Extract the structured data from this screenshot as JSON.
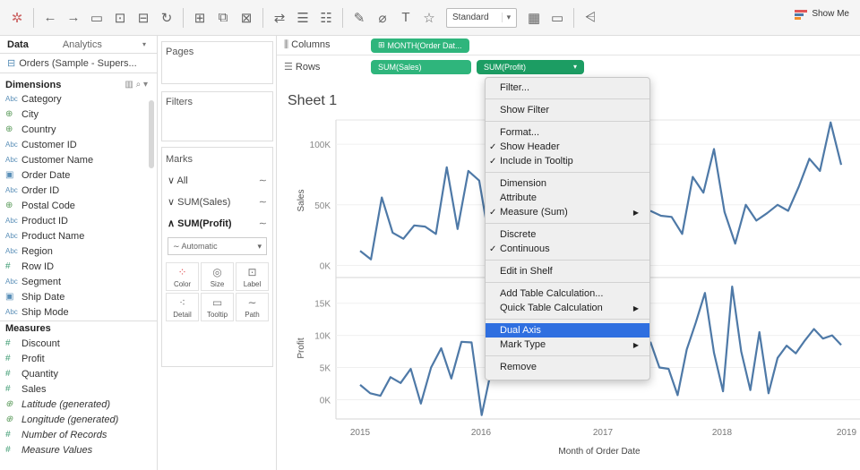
{
  "toolbar": {
    "standard_label": "Standard",
    "show_me": "Show Me"
  },
  "data_pane": {
    "tabs": [
      "Data",
      "Analytics"
    ],
    "data_source": "Orders (Sample - Supers...",
    "dimensions_label": "Dimensions",
    "dimensions": [
      {
        "name": "Category",
        "type": "Abc"
      },
      {
        "name": "City",
        "type": "globe"
      },
      {
        "name": "Country",
        "type": "globe"
      },
      {
        "name": "Customer ID",
        "type": "Abc"
      },
      {
        "name": "Customer Name",
        "type": "Abc"
      },
      {
        "name": "Order Date",
        "type": "cal"
      },
      {
        "name": "Order ID",
        "type": "Abc"
      },
      {
        "name": "Postal Code",
        "type": "globe"
      },
      {
        "name": "Product ID",
        "type": "Abc"
      },
      {
        "name": "Product Name",
        "type": "Abc"
      },
      {
        "name": "Region",
        "type": "Abc"
      },
      {
        "name": "Row ID",
        "type": "num"
      },
      {
        "name": "Segment",
        "type": "Abc"
      },
      {
        "name": "Ship Date",
        "type": "cal"
      },
      {
        "name": "Ship Mode",
        "type": "Abc"
      }
    ],
    "measures_label": "Measures",
    "measures": [
      {
        "name": "Discount",
        "type": "num",
        "italic": false
      },
      {
        "name": "Profit",
        "type": "num",
        "italic": false
      },
      {
        "name": "Quantity",
        "type": "num",
        "italic": false
      },
      {
        "name": "Sales",
        "type": "num",
        "italic": false
      },
      {
        "name": "Latitude (generated)",
        "type": "globe",
        "italic": true
      },
      {
        "name": "Longitude (generated)",
        "type": "globe",
        "italic": true
      },
      {
        "name": "Number of Records",
        "type": "num",
        "italic": true
      },
      {
        "name": "Measure Values",
        "type": "num",
        "italic": true
      }
    ]
  },
  "shelves": {
    "pages_label": "Pages",
    "filters_label": "Filters",
    "marks_label": "Marks",
    "marks_rows": [
      "All",
      "SUM(Sales)",
      "SUM(Profit)"
    ],
    "mark_type": "Automatic",
    "mark_buttons": [
      "Color",
      "Size",
      "Label",
      "Detail",
      "Tooltip",
      "Path"
    ],
    "columns_label": "Columns",
    "rows_label": "Rows",
    "columns_pill": "MONTH(Order Dat...",
    "rows_pills": [
      "SUM(Sales)",
      "SUM(Profit)"
    ]
  },
  "view": {
    "sheet_title": "Sheet 1",
    "x_axis_title": "Month of Order Date",
    "x_ticks": [
      "2015",
      "2016",
      "2017",
      "2018",
      "2019"
    ],
    "sales_axis_title": "Sales",
    "sales_ticks": [
      "100K",
      "50K",
      "0K"
    ],
    "profit_axis_title": "Profit",
    "profit_ticks": [
      "15K",
      "10K",
      "5K",
      "0K"
    ]
  },
  "context_menu": {
    "items": [
      {
        "label": "Filter...",
        "check": false,
        "arrow": false
      },
      "sep",
      {
        "label": "Show Filter",
        "check": false,
        "arrow": false
      },
      "sep",
      {
        "label": "Format...",
        "check": false,
        "arrow": false
      },
      {
        "label": "Show Header",
        "check": true,
        "arrow": false
      },
      {
        "label": "Include in Tooltip",
        "check": true,
        "arrow": false
      },
      "sep",
      {
        "label": "Dimension",
        "check": false,
        "arrow": false
      },
      {
        "label": "Attribute",
        "check": false,
        "arrow": false
      },
      {
        "label": "Measure (Sum)",
        "check": true,
        "arrow": true
      },
      "sep",
      {
        "label": "Discrete",
        "check": false,
        "arrow": false
      },
      {
        "label": "Continuous",
        "check": true,
        "arrow": false
      },
      "sep",
      {
        "label": "Edit in Shelf",
        "check": false,
        "arrow": false
      },
      "sep",
      {
        "label": "Add Table Calculation...",
        "check": false,
        "arrow": false
      },
      {
        "label": "Quick Table Calculation",
        "check": false,
        "arrow": true
      },
      "sep",
      {
        "label": "Dual Axis",
        "check": false,
        "arrow": false,
        "highlight": true
      },
      {
        "label": "Mark Type",
        "check": false,
        "arrow": true
      },
      "sep",
      {
        "label": "Remove",
        "check": false,
        "arrow": false
      }
    ]
  },
  "colors": {
    "pill_green": "#2fb57c",
    "line_blue": "#4e79a7",
    "menu_highlight": "#2f6fe0"
  },
  "chart_data": [
    {
      "type": "line",
      "ylabel": "Sales",
      "xlabel": "Month of Order Date",
      "x_ticks": [
        "2015",
        "2016",
        "2017",
        "2018",
        "2019"
      ],
      "ylim": [
        -10000,
        120000
      ],
      "values_left_of_menu": [
        12000,
        5000,
        56000,
        27000,
        22000,
        33000,
        32000,
        26000,
        81000,
        30000,
        78000,
        70000,
        18000
      ],
      "values_right_of_menu": [
        45000,
        41000,
        40000,
        26000,
        73000,
        60000,
        96000,
        44000,
        18000,
        50000,
        37000,
        43000,
        50000,
        45000,
        65000,
        88000,
        78000,
        118000,
        83000
      ]
    },
    {
      "type": "line",
      "ylabel": "Profit",
      "xlabel": "Month of Order Date",
      "x_ticks": [
        "2015",
        "2016",
        "2017",
        "2018",
        "2019"
      ],
      "ylim": [
        -3000,
        19000
      ],
      "values_left_of_menu": [
        2300,
        1000,
        600,
        3500,
        2600,
        4800,
        -600,
        5000,
        8000,
        3300,
        9000,
        8900,
        -2400,
        5000
      ],
      "values_right_of_menu": [
        9000,
        5000,
        4800,
        700,
        7800,
        12000,
        16600,
        7300,
        1300,
        17600,
        7500,
        1500,
        10500,
        1000,
        6500,
        8400,
        7200,
        9200,
        11000,
        9500,
        10000,
        8500
      ]
    }
  ]
}
